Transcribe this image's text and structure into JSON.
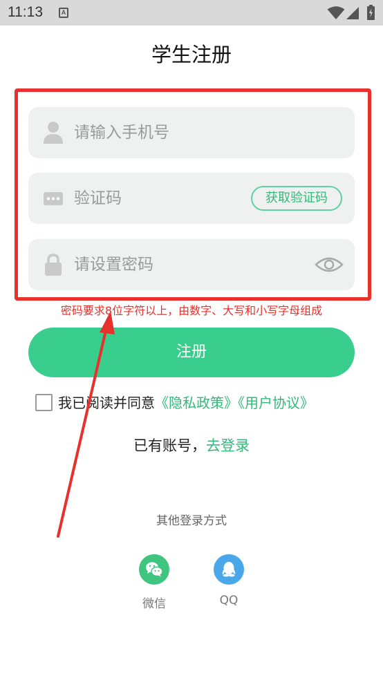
{
  "status_bar": {
    "time": "11:13",
    "notification_letter": "A"
  },
  "page": {
    "title": "学生注册"
  },
  "form": {
    "phone_placeholder": "请输入手机号",
    "code_placeholder": "验证码",
    "get_code_button": "获取验证码",
    "password_placeholder": "请设置密码",
    "password_hint": "密码要求8位字符以上，由数字、大写和小写字母组成"
  },
  "register_button": "注册",
  "agreement": {
    "text": "我已阅读并同意",
    "privacy_link": "《隐私政策》",
    "user_agreement_link": "《用户协议》",
    "checked": false
  },
  "login": {
    "text": "已有账号，",
    "link": "去登录"
  },
  "other_login": {
    "title": "其他登录方式",
    "options": [
      {
        "label": "微信",
        "icon": "wechat-icon"
      },
      {
        "label": "QQ",
        "icon": "qq-icon"
      }
    ]
  },
  "colors": {
    "accent_green": "#3ace8e",
    "annotation_red": "#e8302c",
    "field_bg": "#eff0f0"
  }
}
